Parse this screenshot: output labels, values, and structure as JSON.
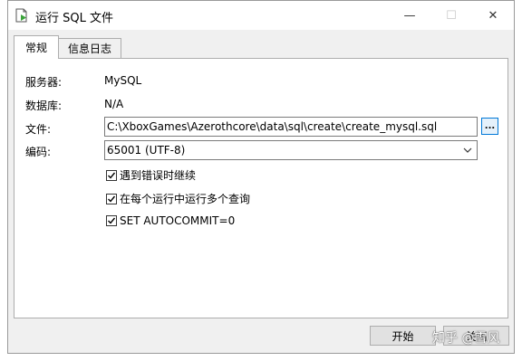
{
  "window": {
    "title": "运行 SQL 文件",
    "minimize_glyph": "—",
    "maximize_glyph": "☐",
    "close_glyph": "✕"
  },
  "tabs": [
    {
      "label": "常规",
      "active": true
    },
    {
      "label": "信息日志",
      "active": false
    }
  ],
  "general": {
    "server_label": "服务器:",
    "server_value": "MySQL",
    "database_label": "数据库:",
    "database_value": "N/A",
    "file_label": "文件:",
    "file_path": "C:\\XboxGames\\Azerothcore\\data\\sql\\create\\create_mysql.sql",
    "browse_label": "...",
    "encoding_label": "编码:",
    "encoding_value": "65001 (UTF-8)"
  },
  "options": [
    {
      "label": "遇到错误时继续",
      "checked": true
    },
    {
      "label": "在每个运行中运行多个查询",
      "checked": true
    },
    {
      "label": "SET AUTOCOMMIT=0",
      "checked": true
    }
  ],
  "buttons": {
    "start_label": "开始",
    "close_label": "关闭"
  },
  "watermark": "知乎 @雪风",
  "icons": {
    "app": "sql-file-run-icon",
    "browse": "ellipsis-icon",
    "dropdown": "chevron-down-icon",
    "checkbox": "check-icon"
  },
  "colors": {
    "accent": "#0078d7",
    "dialog_bg": "#f0f0f0",
    "panel_bg": "#ffffff"
  }
}
